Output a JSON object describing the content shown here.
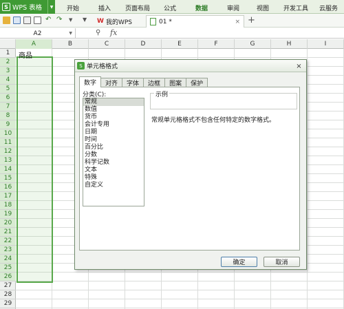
{
  "ribbon": {
    "app_name": "WPS 表格",
    "tabs": [
      "开始",
      "插入",
      "页面布局",
      "公式",
      "数据",
      "审阅",
      "视图",
      "开发工具",
      "云服务"
    ],
    "active_tab": "数据",
    "accent_color": "#3f9a34"
  },
  "toolbar": {
    "tab_wps": "我的WPS",
    "tab_doc": "01 *",
    "add_tab": "+"
  },
  "formula_bar": {
    "name_box": "A2",
    "fx_label": "fx",
    "zoom_icon": "magnifier-icon"
  },
  "grid": {
    "columns": [
      "A",
      "B",
      "C",
      "D",
      "E",
      "F",
      "G",
      "H",
      "I"
    ],
    "selected_column": "A",
    "rows": [
      "1",
      "2",
      "3",
      "4",
      "5",
      "6",
      "7",
      "8",
      "9",
      "10",
      "11",
      "12",
      "13",
      "14",
      "15",
      "16",
      "17",
      "18",
      "19",
      "20",
      "21",
      "22",
      "23",
      "24",
      "25",
      "26",
      "27",
      "28",
      "29"
    ],
    "a1_value": "商品",
    "selection_color": "#58a84a"
  },
  "dialog": {
    "title": "单元格格式",
    "close": "×",
    "tabs": [
      "数字",
      "对齐",
      "字体",
      "边框",
      "图案",
      "保护"
    ],
    "active_tab": "数字",
    "category_label": "分类(C):",
    "categories": [
      "常规",
      "数值",
      "货币",
      "会计专用",
      "日期",
      "时间",
      "百分比",
      "分数",
      "科学记数",
      "文本",
      "特殊",
      "自定义"
    ],
    "selected_category": "常规",
    "sample_label": "示例",
    "description": "常规单元格格式不包含任何特定的数字格式。",
    "ok": "确定",
    "cancel": "取消"
  }
}
